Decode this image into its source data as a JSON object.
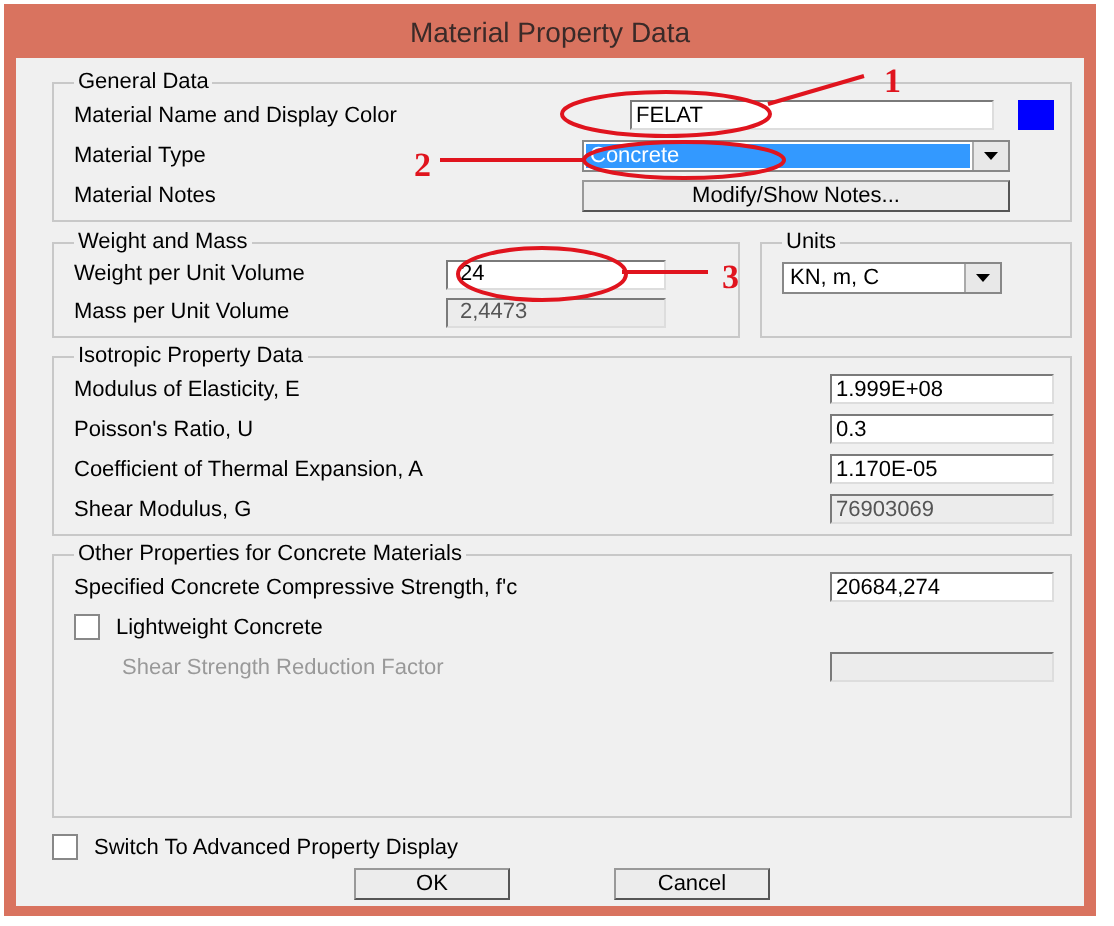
{
  "window": {
    "title": "Material Property Data"
  },
  "general": {
    "title": "General Data",
    "name_label": "Material Name and Display Color",
    "name_value": "FELAT",
    "color": "#0000ff",
    "type_label": "Material Type",
    "type_value": "Concrete",
    "notes_label": "Material Notes",
    "notes_button": "Modify/Show Notes..."
  },
  "weight": {
    "title": "Weight and Mass",
    "rows": [
      {
        "label": "Weight per Unit Volume",
        "value": "24",
        "disabled": false
      },
      {
        "label": "Mass per Unit Volume",
        "value": "2,4473",
        "disabled": true
      }
    ]
  },
  "units": {
    "title": "Units",
    "value": "KN, m, C"
  },
  "isotropic": {
    "title": "Isotropic Property Data",
    "rows": [
      {
        "label": "Modulus of Elasticity, E",
        "value": "1.999E+08",
        "disabled": false
      },
      {
        "label": "Poisson's Ratio, U",
        "value": "0.3",
        "disabled": false
      },
      {
        "label": "Coefficient of Thermal Expansion, A",
        "value": "1.170E-05",
        "disabled": false
      },
      {
        "label": "Shear Modulus, G",
        "value": "76903069",
        "disabled": true
      }
    ]
  },
  "concrete": {
    "title": "Other Properties for Concrete Materials",
    "strength_label": "Specified Concrete Compressive Strength, f'c",
    "strength_value": "20684,274",
    "lightweight": {
      "label": "Lightweight Concrete",
      "checked": false
    },
    "reduction_label": "Shear Strength Reduction Factor"
  },
  "advanced": {
    "label": "Switch To Advanced Property Display",
    "checked": false
  },
  "buttons": [
    "OK",
    "Cancel"
  ],
  "annotations": [
    {
      "label": "1"
    },
    {
      "label": "2"
    },
    {
      "label": "3"
    }
  ]
}
